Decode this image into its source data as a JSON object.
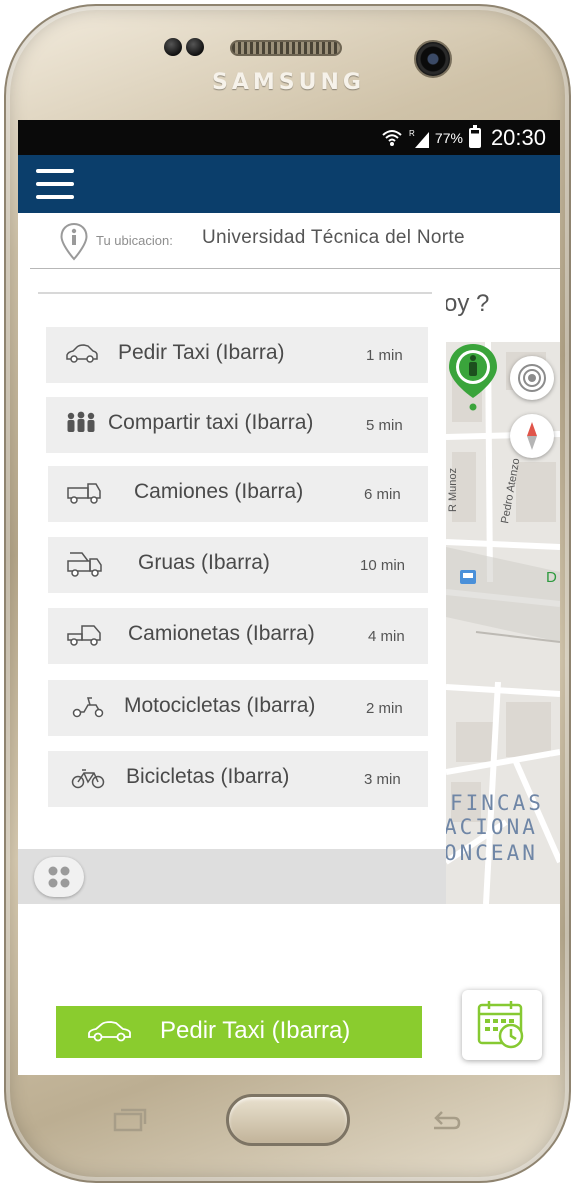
{
  "device": {
    "brand": "SAMSUNG"
  },
  "status_bar": {
    "battery": "77%",
    "time": "20:30"
  },
  "location": {
    "label": "Tu ubicacion:",
    "value": "Universidad Técnica del Norte"
  },
  "question_tail": "oy ?",
  "services": [
    {
      "label": "Pedir Taxi (Ibarra)",
      "time": "1 min",
      "icon": "car-icon"
    },
    {
      "label": "Compartir taxi (Ibarra)",
      "time": "5 min",
      "icon": "people-icon"
    },
    {
      "label": "Camiones (Ibarra)",
      "time": "6 min",
      "icon": "truck-icon"
    },
    {
      "label": "Gruas (Ibarra)",
      "time": "10 min",
      "icon": "tow-truck-icon"
    },
    {
      "label": "Camionetas (Ibarra)",
      "time": "4 min",
      "icon": "pickup-icon"
    },
    {
      "label": "Motocicletas (Ibarra)",
      "time": "2 min",
      "icon": "scooter-icon"
    },
    {
      "label": "Bicicletas (Ibarra)",
      "time": "3 min",
      "icon": "bicycle-icon"
    }
  ],
  "map": {
    "street_1": "R Munoz",
    "street_2": "Pedro Atenzo",
    "poi_letter": "D",
    "area_lines": [
      "FINCAS",
      "ACIONA",
      "ONCEAN"
    ]
  },
  "cta": {
    "label": "Pedir Taxi (Ibarra)"
  },
  "colors": {
    "appbar": "#0b3e6b",
    "cta": "#8acc2e",
    "pin": "#3aa43b"
  }
}
